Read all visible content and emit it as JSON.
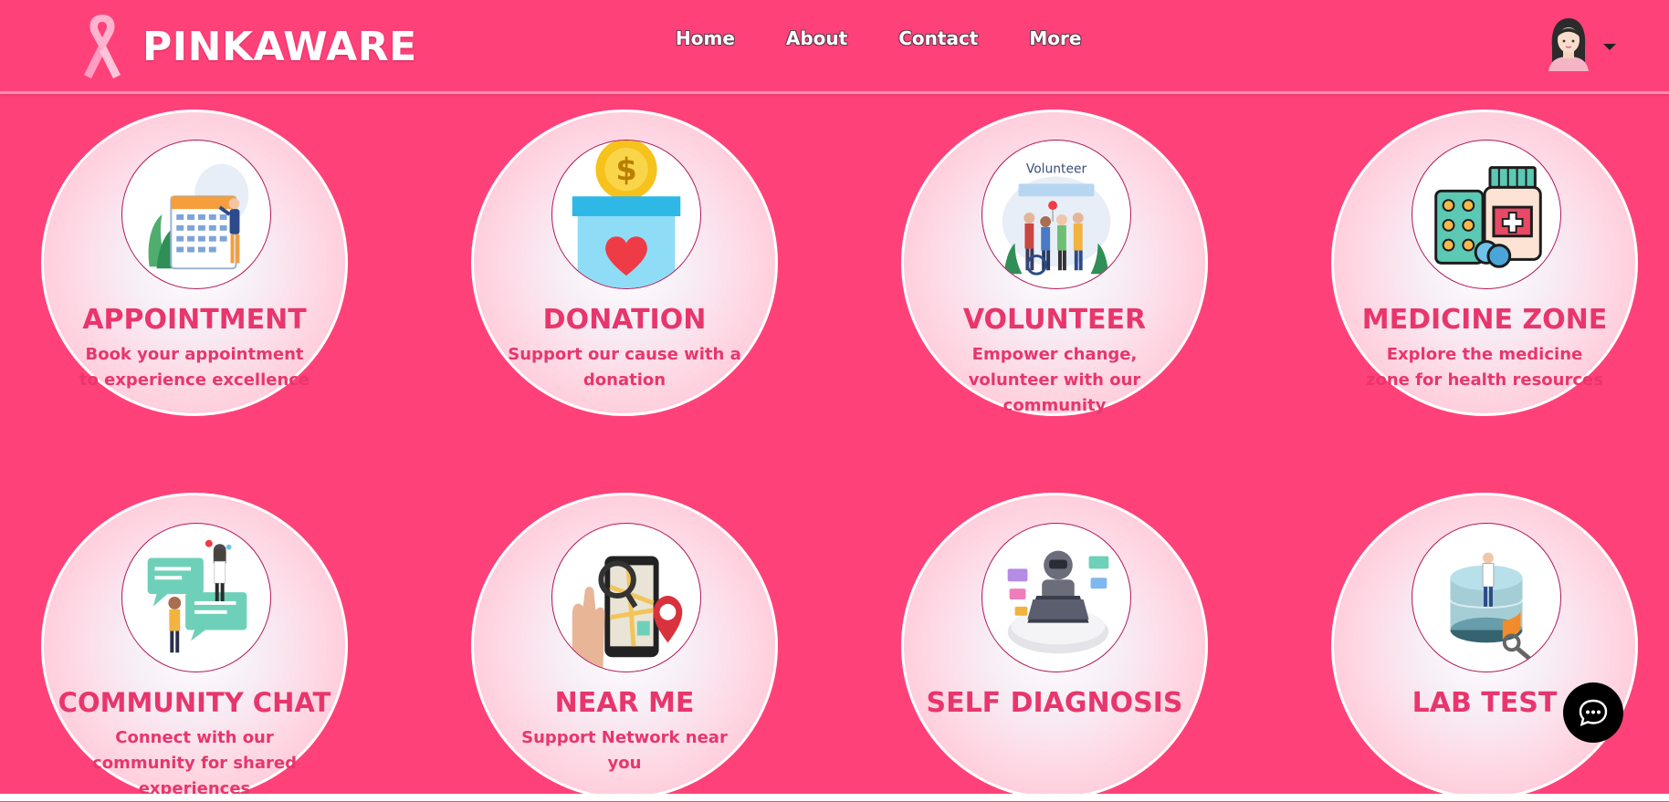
{
  "brand": {
    "name": "PINKAWARE",
    "logo_icon": "pink-ribbon-icon"
  },
  "nav": {
    "items": [
      {
        "label": "Home"
      },
      {
        "label": "About"
      },
      {
        "label": "Contact"
      },
      {
        "label": "More"
      }
    ]
  },
  "user_menu": {
    "avatar_icon": "female-avatar-icon",
    "dropdown_icon": "caret-down-icon"
  },
  "cards": [
    {
      "title": "APPOINTMENT",
      "description": "Book your appointment to experience excellence",
      "icon": "calendar-icon"
    },
    {
      "title": "DONATION",
      "description": "Support our cause with a donation",
      "icon": "donation-box-icon"
    },
    {
      "title": "VOLUNTEER",
      "description": "Empower change, volunteer with our community",
      "icon": "volunteer-group-icon",
      "icon_text": "Volunteer"
    },
    {
      "title": "MEDICINE ZONE",
      "description": "Explore the medicine zone for health resources",
      "icon": "medicine-icon"
    },
    {
      "title": "COMMUNITY CHAT",
      "description": "Connect with our community for shared experiences",
      "icon": "chat-bubbles-icon"
    },
    {
      "title": "NEAR ME",
      "description": "Support Network near you",
      "icon": "map-phone-icon"
    },
    {
      "title": "SELF DIAGNOSIS",
      "description": "",
      "icon": "robot-laptop-icon"
    },
    {
      "title": "LAB TEST",
      "description": "",
      "icon": "lab-test-icon"
    }
  ],
  "chat_widget": {
    "icon": "chat-bubble-icon"
  },
  "colors": {
    "background": "#ff4179",
    "accent_text": "#e8366c",
    "circle_border": "#b0155a",
    "white": "#ffffff"
  }
}
